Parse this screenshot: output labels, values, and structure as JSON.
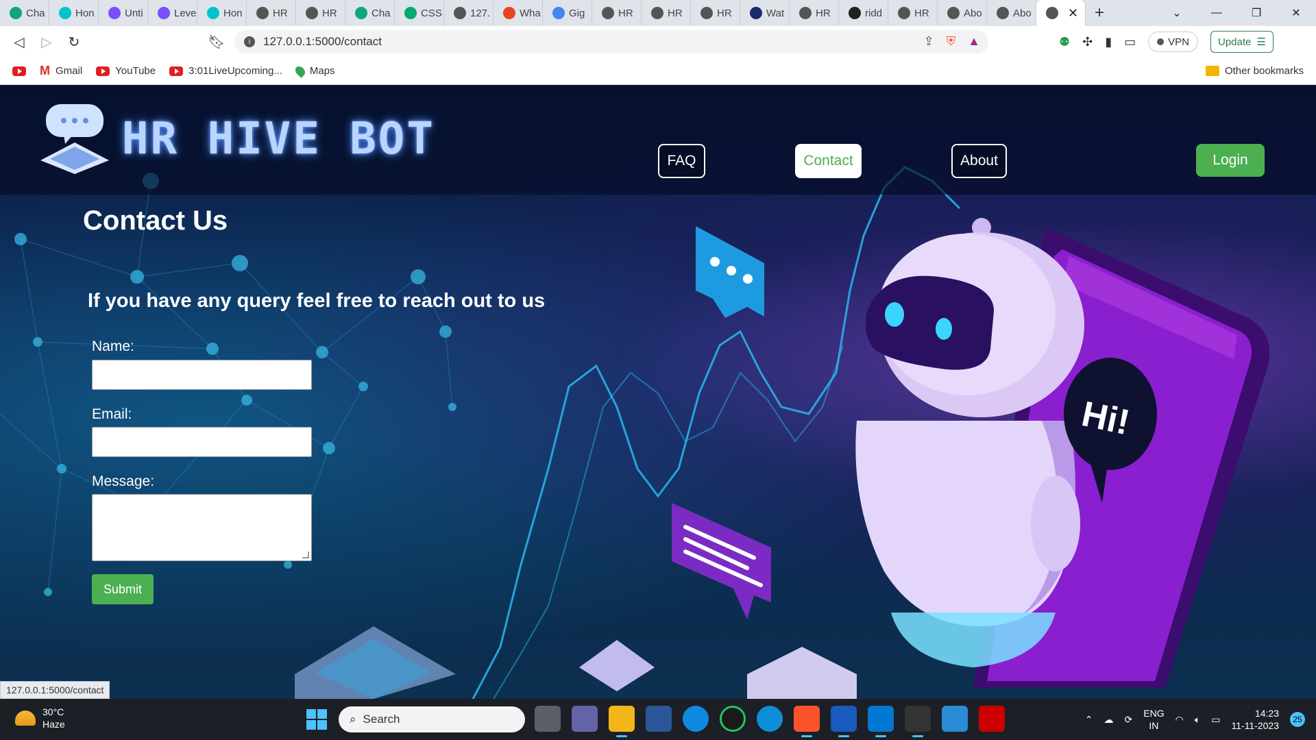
{
  "browser": {
    "tabs": [
      {
        "label": "Cha",
        "icon": "chatgpt-icon",
        "color": "#10a37f"
      },
      {
        "label": "Hon",
        "icon": "canva-icon",
        "color": "#00c4cc"
      },
      {
        "label": "Unti",
        "icon": "form-icon",
        "color": "#7b4dff"
      },
      {
        "label": "Leve",
        "icon": "form-icon",
        "color": "#7b4dff"
      },
      {
        "label": "Hon",
        "icon": "canva-icon",
        "color": "#00c4cc"
      },
      {
        "label": "HR",
        "icon": "globe-icon",
        "color": "#555555"
      },
      {
        "label": "HR",
        "icon": "globe-icon",
        "color": "#555555"
      },
      {
        "label": "Cha",
        "icon": "chatgpt-icon",
        "color": "#10a37f"
      },
      {
        "label": "CSS",
        "icon": "w3schools-icon",
        "color": "#04aa6d"
      },
      {
        "label": "127.",
        "icon": "globe-icon",
        "color": "#555555"
      },
      {
        "label": "Wha",
        "icon": "alert-icon",
        "color": "#e8451e"
      },
      {
        "label": "Gig",
        "icon": "google-icon",
        "color": "#4285f4"
      },
      {
        "label": "HR",
        "icon": "globe-icon",
        "color": "#555555"
      },
      {
        "label": "HR",
        "icon": "globe-icon",
        "color": "#555555"
      },
      {
        "label": "HR",
        "icon": "globe-icon",
        "color": "#555555"
      },
      {
        "label": "Wat",
        "icon": "eh-icon",
        "color": "#1a2a6c"
      },
      {
        "label": "HR",
        "icon": "globe-icon",
        "color": "#555555"
      },
      {
        "label": "ridd",
        "icon": "github-icon",
        "color": "#222222"
      },
      {
        "label": "HR",
        "icon": "globe-icon",
        "color": "#555555"
      },
      {
        "label": "Abo",
        "icon": "globe-icon",
        "color": "#555555"
      },
      {
        "label": "Abo",
        "icon": "globe-icon",
        "color": "#555555"
      }
    ],
    "address": "127.0.0.1:5000/contact",
    "vpn_label": "VPN",
    "update_label": "Update",
    "bookmarks": [
      {
        "label": "",
        "icon": "youtube-icon"
      },
      {
        "label": "Gmail",
        "icon": "gmail-icon"
      },
      {
        "label": "YouTube",
        "icon": "youtube-icon"
      },
      {
        "label": "3:01LiveUpcoming...",
        "icon": "youtube-icon"
      },
      {
        "label": "Maps",
        "icon": "maps-icon"
      }
    ],
    "other_bookmarks": "Other bookmarks",
    "status_url": "127.0.0.1:5000/contact"
  },
  "site": {
    "brand": "HR HIVE BOT",
    "nav": {
      "faq": "FAQ",
      "contact": "Contact",
      "about": "About",
      "login": "Login"
    },
    "accent": "#4CAF50",
    "page_title": "Contact Us",
    "subtitle": "If you have any query feel free to reach out to us",
    "form": {
      "name_label": "Name:",
      "name_value": "",
      "email_label": "Email:",
      "email_value": "",
      "message_label": "Message:",
      "message_value": "",
      "submit_label": "Submit"
    },
    "hero_bubble_text": "Hi!"
  },
  "taskbar": {
    "weather_temp": "30°C",
    "weather_desc": "Haze",
    "search_placeholder": "Search",
    "lang_top": "ENG",
    "lang_bottom": "IN",
    "time": "14:23",
    "date": "11-11-2023",
    "notifications": "25"
  }
}
